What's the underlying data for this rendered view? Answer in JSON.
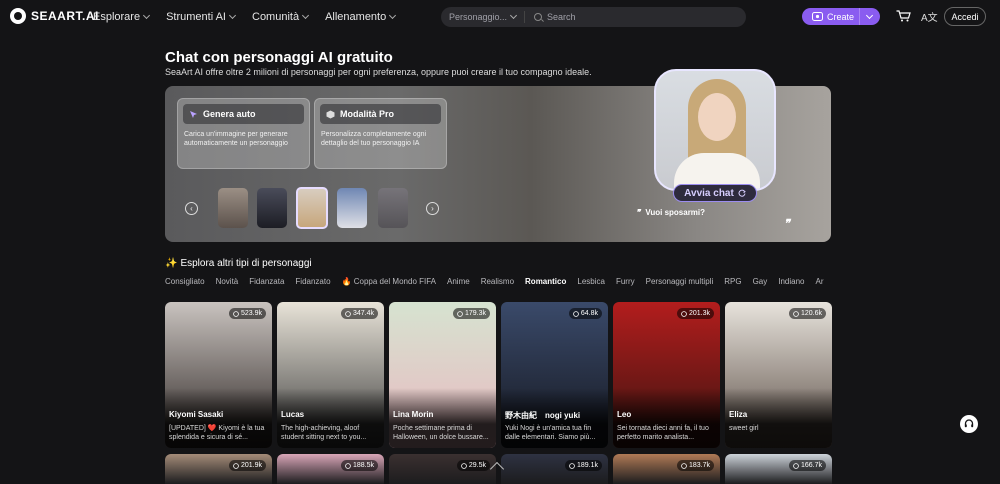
{
  "brand": {
    "name": "SEAART.AI"
  },
  "nav": {
    "items": [
      {
        "label": "Esplorare"
      },
      {
        "label": "Strumenti AI"
      },
      {
        "label": "Comunità"
      },
      {
        "label": "Allenamento"
      }
    ],
    "search_category": "Personaggio...",
    "search_placeholder": "Search",
    "create_label": "Create",
    "lang_label": "A文",
    "login_label": "Accedi"
  },
  "page": {
    "title": "Chat con personaggi AI gratuito",
    "subtitle": "SeaArt AI offre oltre 2 milioni di personaggi per ogni preferenza, oppure puoi creare il tuo compagno ideale."
  },
  "hero": {
    "cards": [
      {
        "title": "Genera auto",
        "desc": "Carica un'immagine per generare automaticamente un personaggio"
      },
      {
        "title": "Modalità Pro",
        "desc": "Personalizza completamente ogni dettaglio del tuo personaggio IA"
      }
    ],
    "chat_button": "Avvia chat",
    "quote": "Vuoi sposarmi?",
    "quote_open": "❞",
    "quote_close": "❞",
    "prev_icon": "‹",
    "next_icon": "›"
  },
  "explore": {
    "title": "Esplora altri tipi di personaggi",
    "sparkle": "✨",
    "tabs": [
      "Consigliato",
      "Novità",
      "Fidanzata",
      "Fidanzato",
      "🔥 Coppa del Mondo FIFA",
      "Anime",
      "Realismo",
      "Romantico",
      "Lesbica",
      "Furry",
      "Personaggi multipli",
      "RPG",
      "Gay",
      "Indiano",
      "Ar"
    ],
    "active_tab": "Romantico"
  },
  "cards": [
    {
      "name": "Kiyomi Sasaki",
      "count": "523.9k",
      "desc": "[UPDATED] ❤️ Kiyomi è la tua splendida e sicura di sé...",
      "c1": "#c9c3bf",
      "c2": "#2b2422"
    },
    {
      "name": "Lucas",
      "count": "347.4k",
      "desc": "The high-achieving, aloof student sitting next to you...",
      "c1": "#e8e3d8",
      "c2": "#3a3a3a"
    },
    {
      "name": "Lina Morin",
      "count": "179.3k",
      "desc": "Poche settimane prima di Halloween, un dolce bussare...",
      "c1": "#d6e3d0",
      "c2": "#e9b8c0"
    },
    {
      "name": "野木由紀　nogi yuki",
      "count": "64.8k",
      "desc": "Yuki Nogi è un'amica tua fin dalle elementari. Siamo più...",
      "c1": "#3a4a6a",
      "c2": "#15171f"
    },
    {
      "name": "Leo",
      "count": "201.3k",
      "desc": "Sei tornata dieci anni fa, il tuo perfetto marito analista...",
      "c1": "#b31d1d",
      "c2": "#3a1410"
    },
    {
      "name": "Eliza",
      "count": "120.6k",
      "desc": "sweet girl",
      "c1": "#e7e3dc",
      "c2": "#5a4c44"
    }
  ],
  "cards_row2": [
    {
      "count": "201.9k",
      "c1": "#a58c78"
    },
    {
      "count": "188.5k",
      "c1": "#d9a6b8"
    },
    {
      "count": "29.5k",
      "c1": "#3b3030"
    },
    {
      "count": "189.1k",
      "c1": "#2e3242"
    },
    {
      "count": "183.7k",
      "c1": "#b07a56"
    },
    {
      "count": "166.7k",
      "c1": "#cdd3da"
    }
  ],
  "colors": {
    "accent": "#8a5cf0",
    "background": "#141416"
  }
}
